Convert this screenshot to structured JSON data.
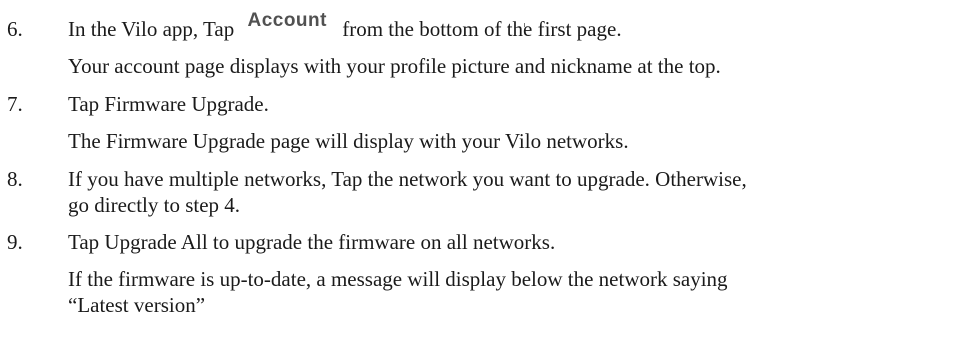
{
  "steps": [
    {
      "number": "6.",
      "text_before": "In the Vilo app, Tap",
      "icon": {
        "name": "account-tab-icon",
        "label": "Account"
      },
      "text_after": "from the bottom of the first page.",
      "result": "Your account page displays with your profile picture and nickname at the top."
    },
    {
      "number": "7.",
      "text": "Tap Firmware Upgrade.",
      "result": "The Firmware Upgrade page will display with your Vilo networks."
    },
    {
      "number": "8.",
      "lines": [
        "If you have multiple networks, Tap the network you want to upgrade. Otherwise,",
        "go directly to step 4."
      ]
    },
    {
      "number": "9.",
      "text": "Tap Upgrade All to upgrade the firmware on all networks.",
      "result_lines": [
        "If the firmware is up-to-date, a message will display below the network saying",
        "“Latest version”"
      ]
    }
  ]
}
